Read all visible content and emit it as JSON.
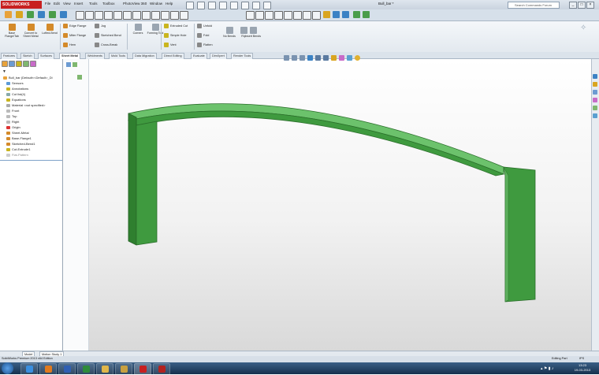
{
  "titlebar": {
    "app_name": "SOLIDWORKS",
    "menu": [
      "File",
      "Edit",
      "View",
      "Insert",
      "Tools",
      "Toolbox",
      "PhotoView 360",
      "Window",
      "Help"
    ],
    "document_title": "Bull_bar *",
    "search_placeholder": "Search Commands Forum"
  },
  "command_manager": {
    "big_buttons": [
      "Base Flange/Tab",
      "Convert to Sheet Metal",
      "Lofted-Bend"
    ],
    "edge_group": [
      "Edge Flange",
      "Miter Flange",
      "Hem"
    ],
    "jog_group": [
      "Jog",
      "Sketched Bend",
      "Cross-Break"
    ],
    "corners_label": "Corners",
    "forming_tool_label": "Forming Tool",
    "extruded_cut_label": "Extruded Cut",
    "simple_hole_label": "Simple Hole",
    "vent_label": "Vent",
    "unfold_label": "Unfold",
    "fold_label": "Fold",
    "flatten_label": "Flatten",
    "no_bends_label": "No Bends",
    "rip_label": "Rip",
    "insert_bends_label": "Insert Bends"
  },
  "tabs": [
    "Features",
    "Sketch",
    "Surfaces",
    "Sheet Metal",
    "Weldments",
    "Mold Tools",
    "Data Migration",
    "Direct Editing",
    "Evaluate",
    "DimXpert",
    "Render Tools"
  ],
  "active_tab": "Sheet Metal",
  "feature_tree": [
    "Bull_bar (Default<<Default>_Di",
    "Sensors",
    "Annotations",
    "Cut list(4)",
    "Equations",
    "Material <not specified>",
    "Front",
    "Top",
    "Right",
    "Origin",
    "Sheet-Metal",
    "Base-Flange1",
    "Sketched-Bend1",
    "Cut-Extrude1",
    "Flat-Pattern"
  ],
  "bottom_tabs": [
    "Model",
    "Motion Study 1"
  ],
  "status_text": "SolidWorks Premium 2013 x64 Edition",
  "status_right": "Editing Part",
  "units": "IPS",
  "clock": {
    "time": "13:23",
    "date": "19-03-2013"
  },
  "colors": {
    "part_green": "#3f9a3f",
    "part_dark": "#2a6e2a",
    "part_light": "#6cc26c",
    "taskbar": "#1f3d60"
  }
}
